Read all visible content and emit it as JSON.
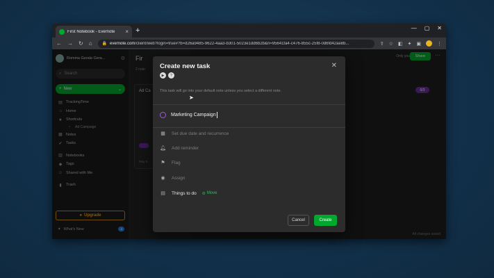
{
  "browser": {
    "tab_title": "First Notebook - Evernote",
    "tab_close": "×",
    "new_tab": "+",
    "win_controls": {
      "minimize": "—",
      "maximize": "▢",
      "close": "✕"
    },
    "nav": {
      "back": "←",
      "forward": "→",
      "reload": "↻",
      "home": "⌂"
    },
    "url_domain": "evernote.com",
    "url_rest": "/client/web?login=true#?b=d26a9485-9622-4aa3-b301-5023e1dd6b2b&n=95641fa4-c476-855c-25f8-0d6fd42ae8b..."
  },
  "sidebar": {
    "user_name": "Romina Gerala Gera...",
    "search_placeholder": "Search",
    "new_label": "New",
    "items": [
      {
        "icon": "note-icon",
        "label": "TrackingTime"
      },
      {
        "icon": "home-icon",
        "label": "Home"
      },
      {
        "icon": "star-icon",
        "label": "Shortcuts"
      },
      {
        "icon": "note-icon",
        "label": "Ad Campaign",
        "sub": true
      },
      {
        "icon": "notes-icon",
        "label": "Notes"
      },
      {
        "icon": "check-icon",
        "label": "Tasks"
      },
      {
        "icon": "book-icon",
        "label": "Notebooks"
      },
      {
        "icon": "tag-icon",
        "label": "Tags"
      },
      {
        "icon": "people-icon",
        "label": "Shared with Me"
      },
      {
        "icon": "trash-icon",
        "label": "Trash"
      }
    ],
    "upgrade_label": "Upgrade",
    "whats_new_label": "What's New",
    "whats_new_badge": "4"
  },
  "notelist": {
    "title": "Fir",
    "subtitle": "2 note",
    "card_title": "Ad Ca",
    "card_date": "May 5"
  },
  "editor": {
    "only_you": "Only you",
    "share_label": "Share",
    "more": "···",
    "tag": "0/3",
    "saved": "All changes saved"
  },
  "modal": {
    "title": "Create new task",
    "close": "✕",
    "hint": "This task will go into your default note unless you select a different note.",
    "task_name": "Marketing Campaign",
    "options": [
      {
        "icon": "calendar-icon",
        "label": "Set due date and recurrence"
      },
      {
        "icon": "bell-icon",
        "label": "Add reminder"
      },
      {
        "icon": "flag-icon",
        "label": "Flag"
      },
      {
        "icon": "person-icon",
        "label": "Assign"
      }
    ],
    "location_label": "Things to do",
    "move_label": "Move",
    "cancel_label": "Cancel",
    "create_label": "Create"
  },
  "colors": {
    "accent_green": "#00a82d",
    "task_purple": "#a05bd6",
    "upgrade_orange": "#e8a21e"
  }
}
